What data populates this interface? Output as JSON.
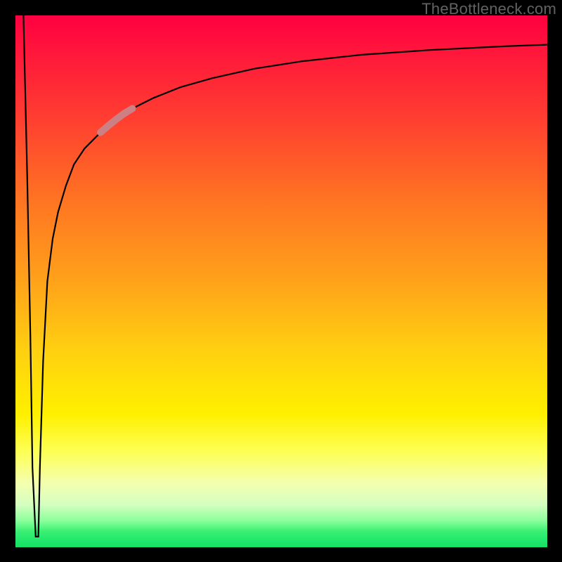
{
  "watermark": "TheBottleneck.com",
  "chart_data": {
    "type": "line",
    "title": "",
    "xlabel": "",
    "ylabel": "",
    "xlim": [
      0,
      100
    ],
    "ylim": [
      0,
      100
    ],
    "grid": false,
    "legend": false,
    "series": [
      {
        "name": "bottleneck-curve",
        "x": [
          1.5,
          2.2,
          2.8,
          3.2,
          3.8,
          4.3,
          4.6,
          5.2,
          6.0,
          7.0,
          8.0,
          9.5,
          11,
          13,
          16,
          19,
          22,
          26,
          31,
          37,
          45,
          54,
          65,
          78,
          92,
          100
        ],
        "y": [
          100,
          70,
          40,
          15,
          2,
          2,
          15,
          35,
          50,
          58,
          63,
          68,
          72,
          75,
          78,
          80.5,
          82.5,
          84.5,
          86.5,
          88.2,
          90,
          91.4,
          92.6,
          93.5,
          94.2,
          94.5
        ]
      },
      {
        "name": "highlight-segment",
        "x": [
          16,
          17.5,
          19,
          20.5,
          22
        ],
        "y": [
          78,
          79.3,
          80.5,
          81.6,
          82.5
        ]
      }
    ],
    "background_gradient_stops": [
      {
        "pos": 0,
        "color": "#ff0040"
      },
      {
        "pos": 20,
        "color": "#ff4030"
      },
      {
        "pos": 50,
        "color": "#ffa21a"
      },
      {
        "pos": 75,
        "color": "#fff000"
      },
      {
        "pos": 92,
        "color": "#d4ffc0"
      },
      {
        "pos": 100,
        "color": "#17e065"
      }
    ]
  }
}
